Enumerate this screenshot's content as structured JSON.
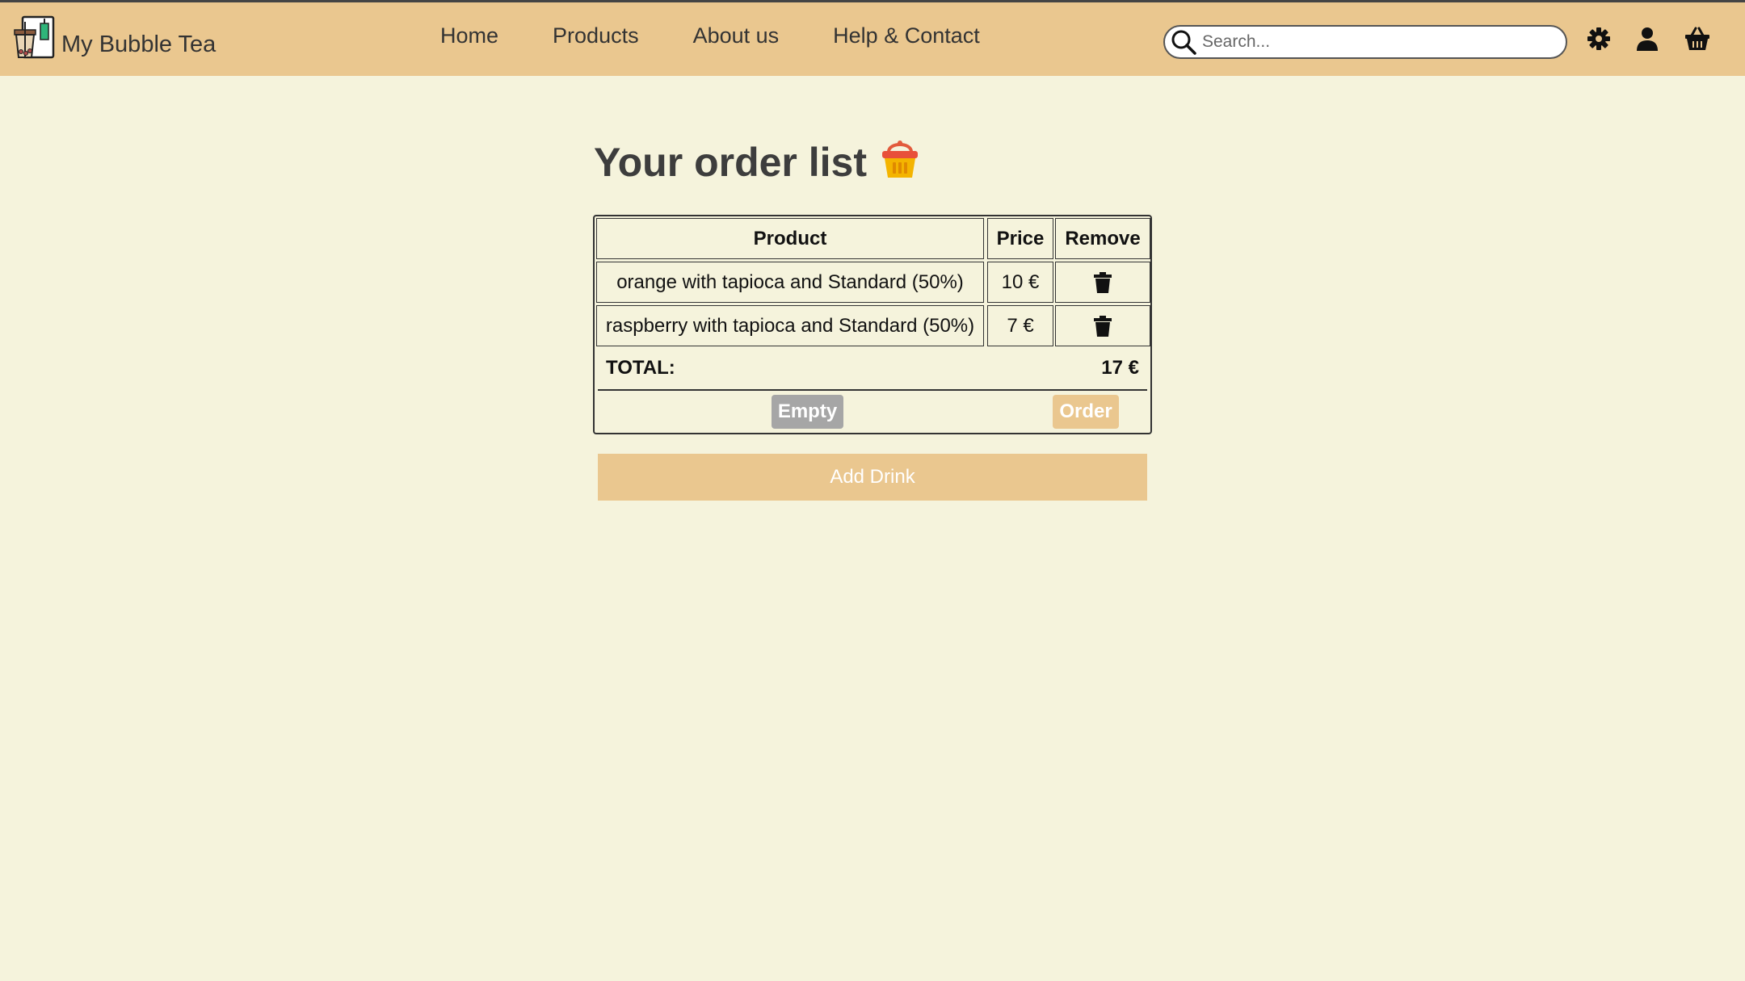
{
  "header": {
    "brand_name": "My Bubble Tea",
    "nav": [
      "Home",
      "Products",
      "About us",
      "Help & Contact"
    ],
    "search_placeholder": "Search...",
    "icons": [
      "settings-gear-icon",
      "user-icon",
      "shopping-basket-icon"
    ]
  },
  "main": {
    "title": "Your order list",
    "title_icon": "basket-icon",
    "table": {
      "headers": [
        "Product",
        "Price",
        "Remove"
      ],
      "rows": [
        {
          "product": "orange with tapioca and Standard (50%)",
          "price": "10 €"
        },
        {
          "product": "raspberry with tapioca and Standard (50%)",
          "price": "7 €"
        }
      ],
      "total_label": "TOTAL:",
      "total_value": "17 €",
      "empty_label": "Empty",
      "order_label": "Order"
    },
    "add_drink_label": "Add Drink"
  },
  "colors": {
    "header_bg": "#eac78f",
    "page_bg": "#f5f3dc",
    "empty_button": "#a6a6a6",
    "accent": "#eac78f"
  }
}
